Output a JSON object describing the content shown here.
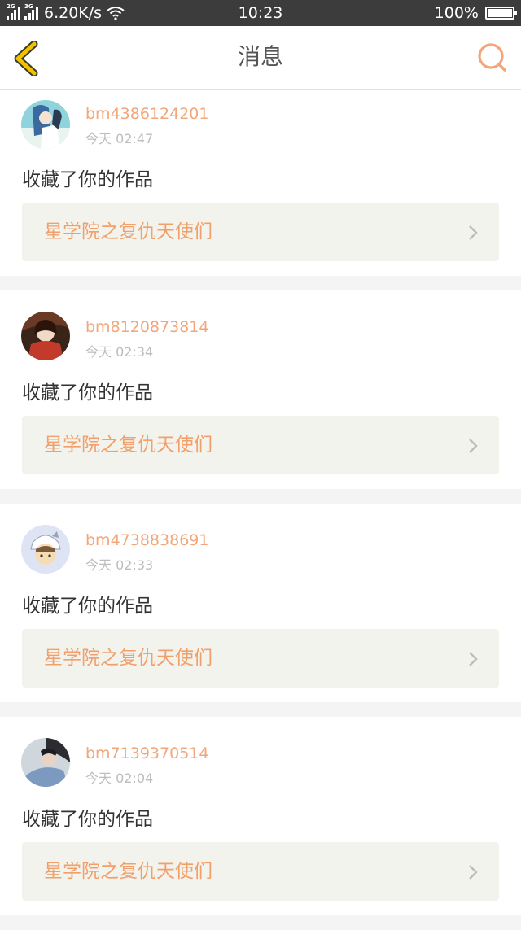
{
  "status_bar": {
    "network_1": "2G",
    "network_2": "3G",
    "speed": "6.20K/s",
    "time": "10:23",
    "battery": "100%"
  },
  "header": {
    "title": "消息",
    "back_icon": "chevron-left-icon",
    "search_icon": "search-icon"
  },
  "colors": {
    "accent": "#f2a679",
    "back_icon": "#f2c200",
    "status_bar": "#3c3c3c"
  },
  "notifications": [
    {
      "username": "bm4386124201",
      "time": "今天 02:47",
      "message": "收藏了你的作品",
      "work_title": "星学院之复仇天使们"
    },
    {
      "username": "bm8120873814",
      "time": "今天 02:34",
      "message": "收藏了你的作品",
      "work_title": "星学院之复仇天使们"
    },
    {
      "username": "bm4738838691",
      "time": "今天 02:33",
      "message": "收藏了你的作品",
      "work_title": "星学院之复仇天使们"
    },
    {
      "username": "bm7139370514",
      "time": "今天 02:04",
      "message": "收藏了你的作品",
      "work_title": "星学院之复仇天使们"
    }
  ]
}
